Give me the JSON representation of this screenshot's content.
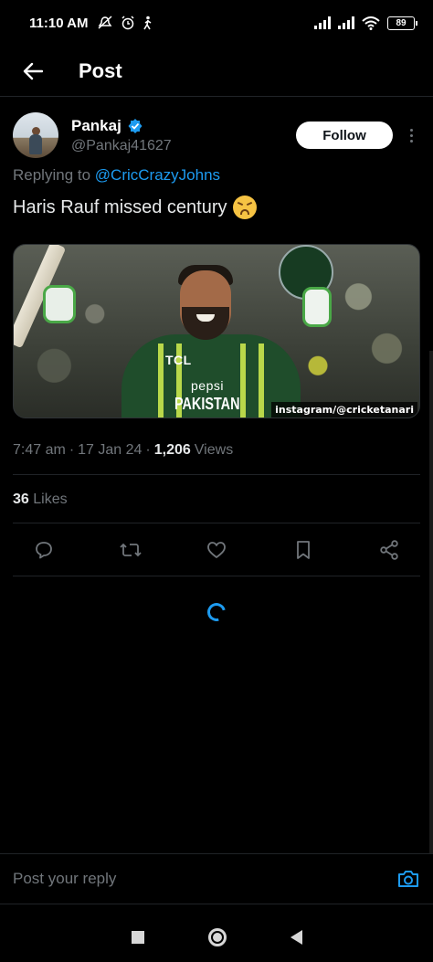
{
  "status_bar": {
    "time": "11:10 AM",
    "battery": "89"
  },
  "header": {
    "title": "Post"
  },
  "author": {
    "name": "Pankaj",
    "handle": "@Pankaj41627",
    "verified": true,
    "follow_label": "Follow"
  },
  "reply": {
    "prefix": "Replying to",
    "to_handle": "@CricCrazyJohns"
  },
  "post": {
    "text": "Haris Rauf missed century",
    "emoji": "confounded-face",
    "media": {
      "sponsor_1": "TCL",
      "sponsor_2": "pepsi",
      "team_text": "PAKISTAN",
      "watermark": "instagram/@cricketanari"
    }
  },
  "meta": {
    "time": "7:47 am",
    "separator": "·",
    "date": "17 Jan 24",
    "views_count": "1,206",
    "views_label": "Views"
  },
  "stats": {
    "likes_count": "36",
    "likes_label": "Likes"
  },
  "reply_bar": {
    "placeholder": "Post your reply"
  },
  "colors": {
    "accent": "#1d9bf0",
    "background": "#000000",
    "muted": "#71767b"
  }
}
